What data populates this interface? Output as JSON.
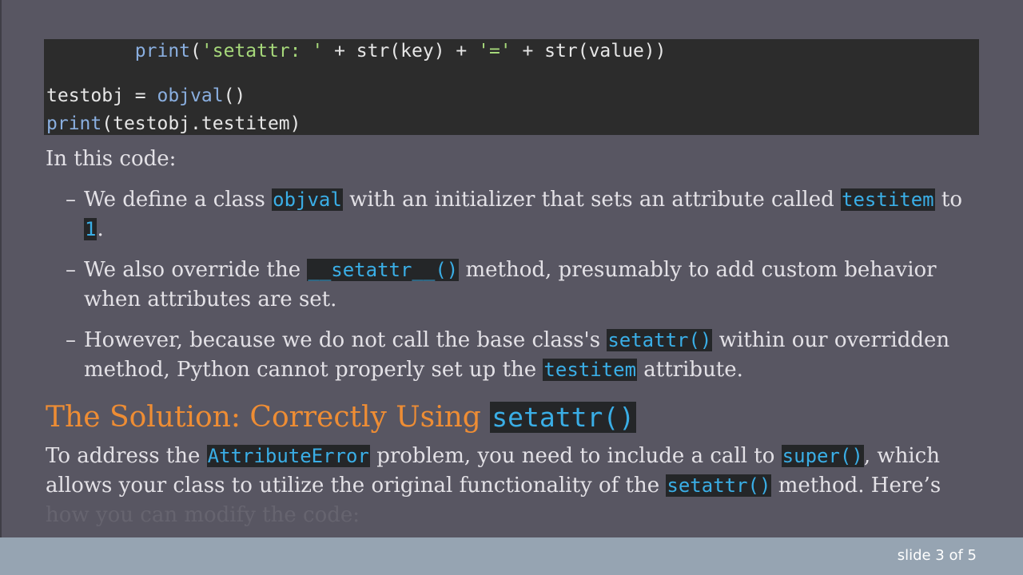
{
  "code": {
    "line1": {
      "indent": "        ",
      "fn": "print",
      "open": "(",
      "str1": "'setattr: '",
      "mid1": " + str(key) + ",
      "str2": "'='",
      "mid2": " + str(value))"
    },
    "line2": {
      "prefix": "testobj = ",
      "fn": "objval",
      "suffix": "()"
    },
    "line3": {
      "fn": "print",
      "suffix": "(testobj.testitem)"
    }
  },
  "intro": "In this code:",
  "bullets": {
    "dash": "–",
    "b1": {
      "t1": "We define a class ",
      "c1": "objval",
      "t2": " with an initializer that sets an attribute called ",
      "c2": "testitem",
      "t3": " to ",
      "c3": "1",
      "t4": "."
    },
    "b2": {
      "t1": "We also override the ",
      "c1": "__setattr__()",
      "t2": " method, presumably to add custom behavior when attributes are set."
    },
    "b3": {
      "t1": "However, because we do not call the base class's ",
      "c1": "setattr()",
      "t2": " within our overridden method, Python cannot properly set up the ",
      "c2": "testitem",
      "t3": " attribute."
    }
  },
  "heading": {
    "text": "The Solution: Correctly Using ",
    "code": "setattr()"
  },
  "body": {
    "t1": "To address the ",
    "c1": "AttributeError",
    "t2": " problem, you need to include a call to ",
    "c2": "super()",
    "t3": ", which allows your class to utilize the original functionality of the ",
    "c3": "setattr()",
    "t4": " method. Here’s ",
    "faded": "how you can modify the code:"
  },
  "footer": {
    "slide_label": "slide 3 of 5"
  },
  "colors": {
    "background": "#585662",
    "heading": "#ee8d34",
    "inline_code": "#3aaee6",
    "footer": "#96a4b2"
  }
}
